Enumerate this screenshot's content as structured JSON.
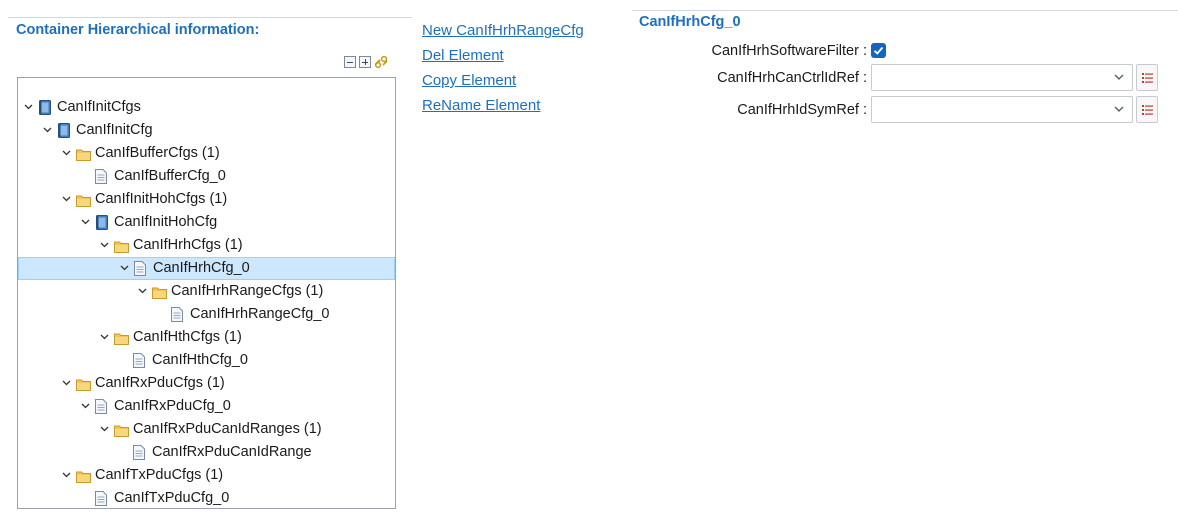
{
  "left_panel": {
    "title": "Container Hierarchical information:",
    "toolbar": {
      "collapse_icon": "collapse-all-icon",
      "expand_icon": "expand-all-icon",
      "link_icon": "link-with-editor-icon"
    },
    "tree": [
      {
        "label": "CanIfInitCfgs",
        "icon": "container-icon",
        "expanded": true,
        "level": 0
      },
      {
        "label": "CanIfInitCfg",
        "icon": "container-icon",
        "expanded": true,
        "level": 1
      },
      {
        "label": "CanIfBufferCfgs (1)",
        "icon": "folder-icon",
        "expanded": true,
        "level": 2
      },
      {
        "label": "CanIfBufferCfg_0",
        "icon": "document-icon",
        "expanded": null,
        "level": 3
      },
      {
        "label": "CanIfInitHohCfgs (1)",
        "icon": "folder-icon",
        "expanded": true,
        "level": 2
      },
      {
        "label": "CanIfInitHohCfg",
        "icon": "container-icon",
        "expanded": true,
        "level": 3
      },
      {
        "label": "CanIfHrhCfgs (1)",
        "icon": "folder-icon",
        "expanded": true,
        "level": 4
      },
      {
        "label": "CanIfHrhCfg_0",
        "icon": "document-icon",
        "expanded": true,
        "level": 5,
        "selected": true
      },
      {
        "label": "CanIfHrhRangeCfgs (1)",
        "icon": "folder-icon",
        "expanded": true,
        "level": 6
      },
      {
        "label": "CanIfHrhRangeCfg_0",
        "icon": "document-icon",
        "expanded": null,
        "level": 7
      },
      {
        "label": "CanIfHthCfgs (1)",
        "icon": "folder-icon",
        "expanded": true,
        "level": 4
      },
      {
        "label": "CanIfHthCfg_0",
        "icon": "document-icon",
        "expanded": null,
        "level": 5
      },
      {
        "label": "CanIfRxPduCfgs (1)",
        "icon": "folder-icon",
        "expanded": true,
        "level": 2
      },
      {
        "label": "CanIfRxPduCfg_0",
        "icon": "document-icon",
        "expanded": true,
        "level": 3
      },
      {
        "label": "CanIfRxPduCanIdRanges (1)",
        "icon": "folder-icon",
        "expanded": true,
        "level": 4
      },
      {
        "label": "CanIfRxPduCanIdRange",
        "icon": "document-icon",
        "expanded": null,
        "level": 5
      },
      {
        "label": "CanIfTxPduCfgs (1)",
        "icon": "folder-icon",
        "expanded": true,
        "level": 2
      },
      {
        "label": "CanIfTxPduCfg_0",
        "icon": "document-icon",
        "expanded": null,
        "level": 3
      }
    ]
  },
  "actions": {
    "new_label": "New CanIfHrhRangeCfg",
    "del_label": "Del Element",
    "copy_label": "Copy Element",
    "rename_label": "ReName Element"
  },
  "right_panel": {
    "title": "CanIfHrhCfg_0",
    "software_filter_label": "CanIfHrhSoftwareFilter :",
    "software_filter_checked": true,
    "can_ctrl_ref_label": "CanIfHrhCanCtrlIdRef :",
    "can_ctrl_ref_value": "",
    "id_sym_ref_label": "CanIfHrhIdSymRef :",
    "id_sym_ref_value": ""
  },
  "colors": {
    "accent": "#1e6fc0",
    "selection": "#cce8ff",
    "checkbox": "#1565c0",
    "folder": "#f2c45a"
  }
}
